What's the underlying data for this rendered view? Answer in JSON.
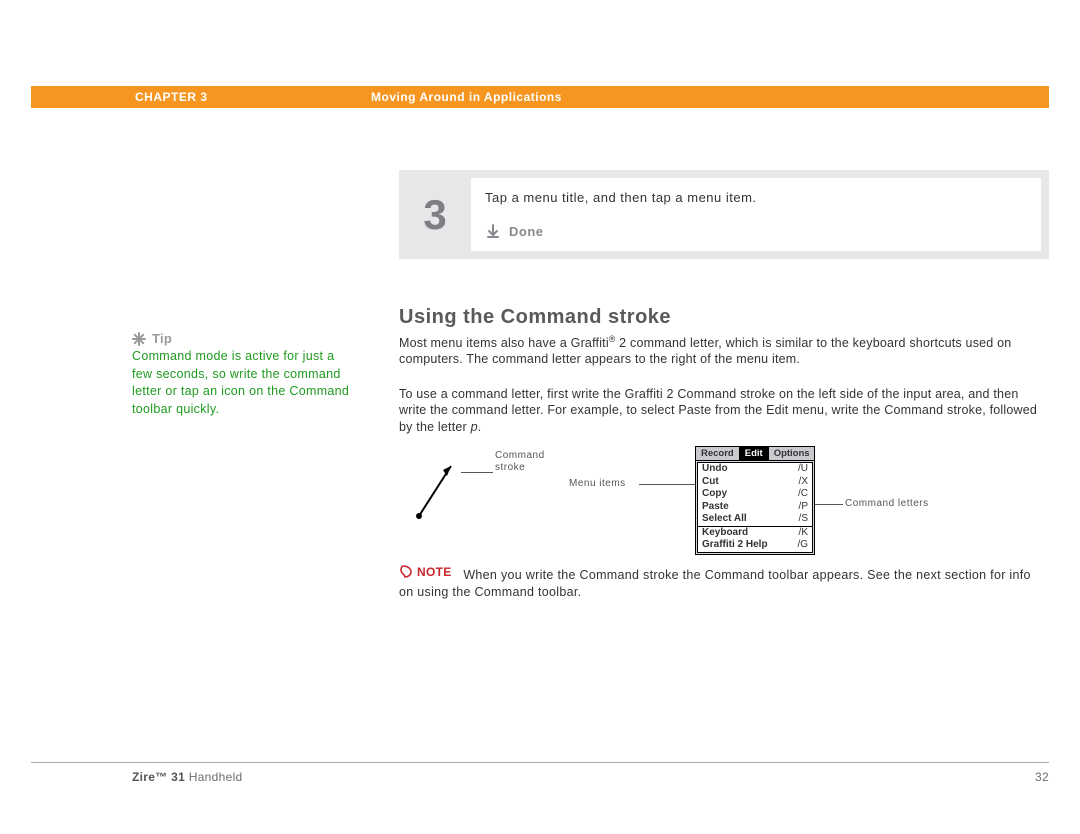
{
  "header": {
    "chapter": "CHAPTER 3",
    "title": "Moving Around in Applications"
  },
  "step": {
    "number": "3",
    "text": "Tap a menu title, and then tap a menu item.",
    "done_label": "Done"
  },
  "tip": {
    "label": "Tip",
    "body": "Command mode is active for just a few seconds, so write the command letter or tap an icon on the Command toolbar quickly."
  },
  "section": {
    "heading": "Using the Command stroke",
    "para1_a": "Most menu items also have a Graffiti",
    "para1_b": " 2 command letter, which is similar to the keyboard shortcuts used on computers. The command letter appears to the right of the menu item.",
    "para2_a": "To use a command letter, first write the Graffiti 2 Command stroke on the left side of the input area, and then write the command letter. For example, to select Paste from the Edit menu, write the Command stroke, followed by the letter ",
    "para2_italic": "p",
    "para2_b": "."
  },
  "figure": {
    "cmd_stroke_label": "Command stroke",
    "menu_items_label": "Menu items",
    "cmd_letters_label": "Command letters"
  },
  "palm_menu": {
    "tabs": [
      "Record",
      "Edit",
      "Options"
    ],
    "active_tab": "Edit",
    "items_block1": [
      {
        "label": "Undo",
        "shortcut": "/U"
      },
      {
        "label": "Cut",
        "shortcut": "/X"
      },
      {
        "label": "Copy",
        "shortcut": "/C"
      },
      {
        "label": "Paste",
        "shortcut": "/P"
      },
      {
        "label": "Select All",
        "shortcut": "/S"
      }
    ],
    "items_block2": [
      {
        "label": "Keyboard",
        "shortcut": "/K"
      },
      {
        "label": "Graffiti 2 Help",
        "shortcut": "/G"
      }
    ]
  },
  "note": {
    "badge": "NOTE",
    "text_a": "When you write the Command stroke the Command toolbar appears. See the next section for info on using the Command toolbar."
  },
  "footer": {
    "product_bold": "Zire™ 31",
    "product_rest": " Handheld",
    "page": "32"
  }
}
